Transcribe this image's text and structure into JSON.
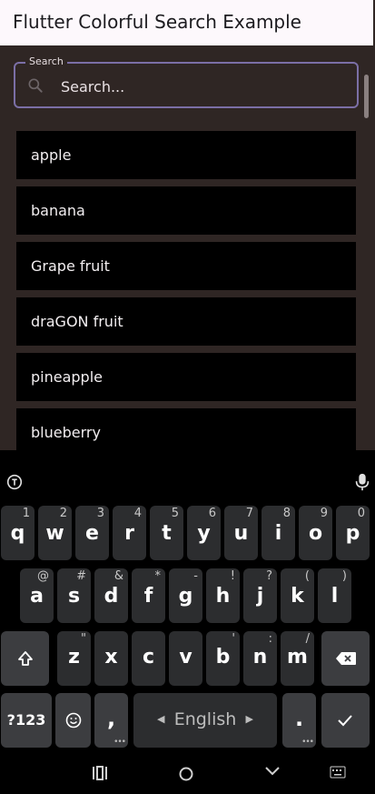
{
  "app": {
    "title": "Flutter Colorful Search Example"
  },
  "search": {
    "label": "Search",
    "placeholder": "Search..."
  },
  "items": [
    "apple",
    "banana",
    "Grape fruit",
    "draGON fruit",
    "pineapple",
    "blueberry"
  ],
  "keyboard": {
    "row1": [
      {
        "key": "q",
        "hint": "1"
      },
      {
        "key": "w",
        "hint": "2"
      },
      {
        "key": "e",
        "hint": "3"
      },
      {
        "key": "r",
        "hint": "4"
      },
      {
        "key": "t",
        "hint": "5"
      },
      {
        "key": "y",
        "hint": "6"
      },
      {
        "key": "u",
        "hint": "7"
      },
      {
        "key": "i",
        "hint": "8"
      },
      {
        "key": "o",
        "hint": "9"
      },
      {
        "key": "p",
        "hint": "0"
      }
    ],
    "row2": [
      {
        "key": "a",
        "hint": "@"
      },
      {
        "key": "s",
        "hint": "#"
      },
      {
        "key": "d",
        "hint": "&"
      },
      {
        "key": "f",
        "hint": "*"
      },
      {
        "key": "g",
        "hint": "-"
      },
      {
        "key": "h",
        "hint": "!"
      },
      {
        "key": "j",
        "hint": "?"
      },
      {
        "key": "k",
        "hint": "("
      },
      {
        "key": "l",
        "hint": ")"
      }
    ],
    "row3": [
      {
        "key": "z",
        "hint": "\""
      },
      {
        "key": "x",
        "hint": ""
      },
      {
        "key": "c",
        "hint": ""
      },
      {
        "key": "v",
        "hint": ""
      },
      {
        "key": "b",
        "hint": "'"
      },
      {
        "key": "n",
        "hint": ":"
      },
      {
        "key": "m",
        "hint": "/"
      }
    ],
    "symbols_label": "?123",
    "comma_label": ",",
    "space_label": "English",
    "period_label": "."
  },
  "colors": {
    "background": "#2f2624",
    "app_bar": "#fdf8fc",
    "search_border": "#7b6fa6",
    "list_item": "#000000",
    "keyboard": "#000000",
    "key": "#2c2d2f"
  }
}
